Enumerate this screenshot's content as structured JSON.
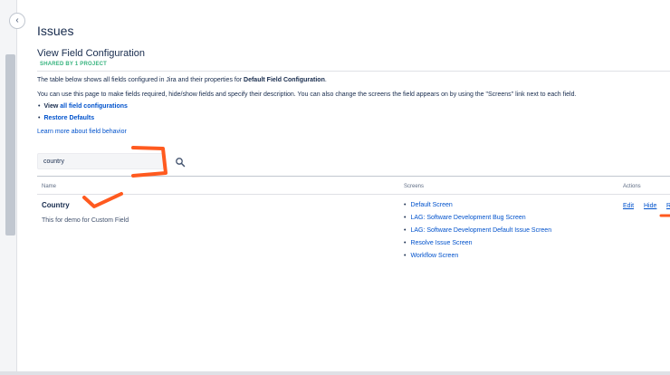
{
  "header": {
    "project_title": "Issues",
    "page_title": "View Field Configuration",
    "shared_badge": "SHARED BY 1 PROJECT"
  },
  "description": {
    "line1_prefix": "The table below shows all fields configured in Jira and their properties for ",
    "line1_bold": "Default Field Configuration",
    "line1_suffix": ".",
    "line2": "You can use this page to make fields required, hide/show fields and specify their description. You can also change the screens the field appears on by using the \"Screens\" link next to each field."
  },
  "links": {
    "view_all_prefix": "View ",
    "view_all_link": "all field configurations",
    "restore_defaults": "Restore Defaults",
    "learn_more": "Learn more about field behavior"
  },
  "search": {
    "value": "country"
  },
  "table": {
    "headers": {
      "name": "Name",
      "screens": "Screens",
      "actions": "Actions"
    },
    "rows": [
      {
        "name": "Country",
        "description": "This for demo for Custom Field",
        "screens": [
          "Default Screen",
          "LAG: Software Development Bug Screen",
          "LAG: Software Development Default Issue Screen",
          "Resolve Issue Screen",
          "Workflow Screen"
        ],
        "actions": {
          "edit": "Edit",
          "hide": "Hide",
          "more": "R"
        }
      }
    ]
  },
  "colors": {
    "link": "#0052cc",
    "text": "#172b4d",
    "shared_badge": "#36b37e",
    "annotation": "#ff5a1f"
  },
  "icons": {
    "collapse": "chevron-left-icon",
    "search": "search-icon"
  }
}
